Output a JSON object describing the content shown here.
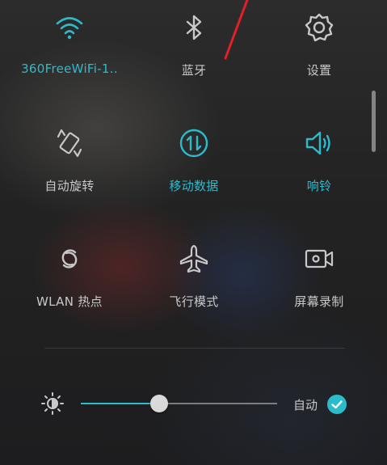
{
  "colors": {
    "accent": "#2bbccc",
    "inactive": "#c8c8c8",
    "annotation_arrow": "#e0202a"
  },
  "tiles": [
    {
      "label": "360FreeWiFi-1..",
      "icon": "wifi-icon",
      "active": true
    },
    {
      "label": "蓝牙",
      "icon": "bluetooth-icon",
      "active": false
    },
    {
      "label": "设置",
      "icon": "gear-icon",
      "active": false
    },
    {
      "label": "自动旋转",
      "icon": "auto-rotate-icon",
      "active": false
    },
    {
      "label": "移动数据",
      "icon": "mobile-data-icon",
      "active": true
    },
    {
      "label": "响铃",
      "icon": "speaker-icon",
      "active": true
    },
    {
      "label": "WLAN 热点",
      "icon": "hotspot-icon",
      "active": false
    },
    {
      "label": "飞行模式",
      "icon": "airplane-icon",
      "active": false
    },
    {
      "label": "屏幕录制",
      "icon": "screen-record-icon",
      "active": false
    }
  ],
  "brightness": {
    "icon": "brightness-icon",
    "level_fraction": 0.4,
    "auto_label": "自动",
    "auto_enabled": true
  }
}
